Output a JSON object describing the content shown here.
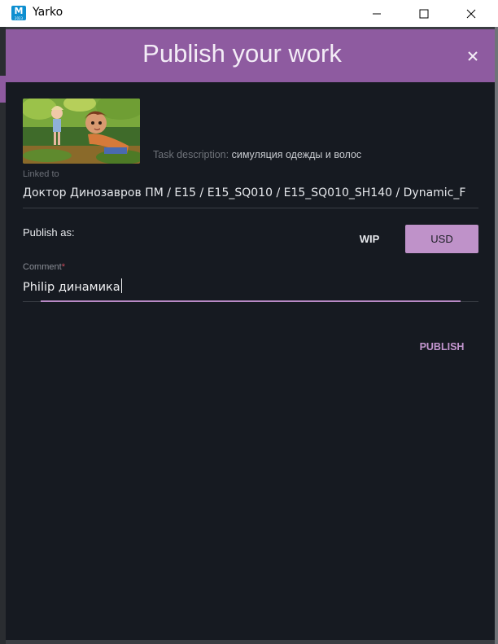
{
  "window": {
    "title": "Yarko",
    "app_icon_letter": "M",
    "app_icon_sub": "2023"
  },
  "dialog": {
    "title": "Publish your work",
    "task_description_label": "Task description:",
    "task_description_value": "симуляция одежды и волос",
    "linked_label": "Linked to",
    "linked_value": "Доктор Динозавров ПМ / E15 / E15_SQ010 / E15_SQ010_SH140 / Dynamic_F",
    "publish_as_label": "Publish as:",
    "publish_options": [
      "WIP",
      "USD"
    ],
    "selected_option": "USD",
    "comment_label": "Comment",
    "comment_required_mark": "*",
    "comment_value": "Philip динамика",
    "publish_button": "PUBLISH"
  },
  "colors": {
    "header": "#8e5ba0",
    "accent": "#bf92c9",
    "background": "#161a21"
  }
}
